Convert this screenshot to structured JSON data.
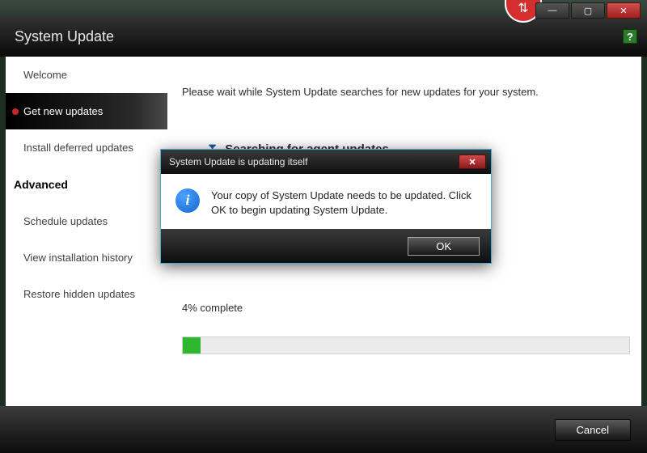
{
  "titlebar": {
    "title": "System Update"
  },
  "window_controls": {
    "minimize": "—",
    "maximize": "▢",
    "close": "✕"
  },
  "header_icons": {
    "red_arrows": "⇅",
    "help": "?"
  },
  "sidebar": {
    "items": [
      {
        "label": "Welcome"
      },
      {
        "label": "Get new updates"
      },
      {
        "label": "Install deferred updates"
      }
    ],
    "heading": "Advanced",
    "advanced_items": [
      {
        "label": "Schedule updates"
      },
      {
        "label": "View installation history"
      },
      {
        "label": "Restore hidden updates"
      }
    ]
  },
  "main": {
    "wait_msg": "Please wait while System Update searches for new updates for your system.",
    "task_label": "Searching for agent updates",
    "progress_text": "4% complete",
    "progress_pct": 4
  },
  "footer": {
    "cancel": "Cancel"
  },
  "dialog": {
    "title": "System Update is updating itself",
    "close_glyph": "✕",
    "info_glyph": "i",
    "body": "Your copy of System Update needs to be updated. Click OK to begin updating System Update.",
    "ok": "OK"
  }
}
